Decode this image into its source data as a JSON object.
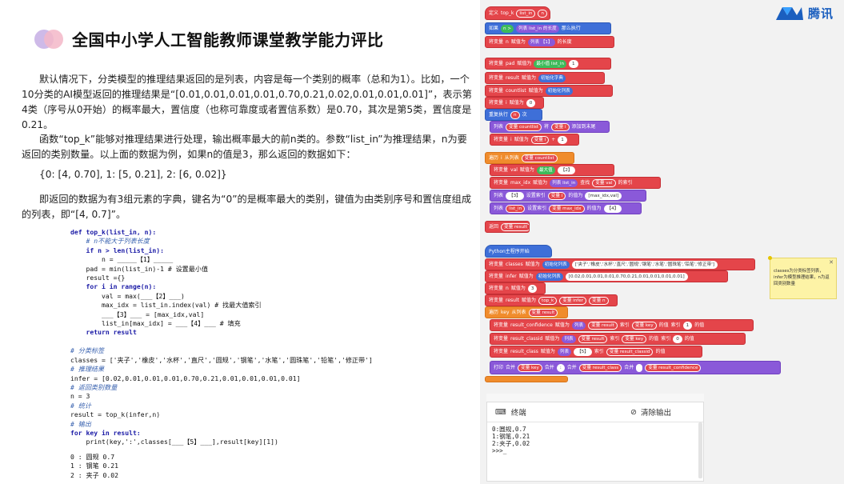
{
  "slide": {
    "title": "全国中小学人工智能教师课堂教学能力评比",
    "p1": "默认情况下，分类模型的推理结果返回的是列表，内容是每一个类别的概率（总和为1）。比如，一个10分类的AI模型返回的推理结果是“[0.01,0.01,0.01,0.01,0.70,0.21,0.02,0.01,0.01,0.01]”，表示第4类（序号从0开始）的概率最大，置信度（也称可靠度或者置信系数）是0.70，其次是第5类，置信度是0.21。",
    "p2": "函数“top_k”能够对推理结果进行处理，输出概率最大的前n类的。参数“list_in”为推理结果，n为要返回的类别数量。以上面的数据为例，如果n的值是3，那么返回的数据如下：",
    "p3": "{0: [4, 0.70], 1: [5, 0.21], 2: [6, 0.02]}",
    "p4": "即返回的数据为有3组元素的字典，键名为“0”的是概率最大的类别，键值为由类别序号和置信度组成的列表，即“[4, 0.7]”。",
    "code": [
      "def top_k(list_in, n):",
      "    # n不能大于列表长度",
      "    if n > len(list_in):",
      "        n = _____【1】_____",
      "    pad = min(list_in)-1 # 设置最小值",
      "    result ={}",
      "    for i in range(n):",
      "        val = max(___【2】___)",
      "        max_idx = list_in.index(val) # 找最大值索引",
      "        ___【3】___ = [max_idx,val]",
      "        list_in[max_idx] = ___【4】___ # 填充",
      "    return result",
      "",
      "# 分类标签",
      "classes = ['夹子','橡皮','水杯','直尺','圆规','钢笔','水笔','圆珠笔','铅笔','修正带']",
      "# 推理结果",
      "infer = [0.02,0.01,0.01,0.01,0.70,0.21,0.01,0.01,0.01,0.01]",
      "# 返回类别数量",
      "n = 3",
      "# 统计",
      "result = top_k(infer,n)",
      "# 输出",
      "for key in result:",
      "    print(key,':',classes[___【5】___],result[key][1])"
    ],
    "output": [
      "0 : 圆规 0.7",
      "1 : 钢笔 0.21",
      "2 : 夹子 0.02"
    ]
  },
  "brand": {
    "name": "腾讯"
  },
  "blocks": {
    "def": "定义",
    "fname": "top_k",
    "arg1": "list_in",
    "arg2": "n",
    "if": "如果",
    "gt": ">",
    "list_len_a": "列表",
    "list_len_b": "的长度",
    "exec": "那么执行",
    "setvar": "将变量",
    "n": "n",
    "assign": "赋值为",
    "list": "列表",
    "blank1": "【1】",
    "len_suffix": "的长度",
    "pad": "pad",
    "min": "最小值",
    "minus_one": "1",
    "result": "result",
    "empty_dict": "初始化字典",
    "countlist": "countlist",
    "empty_list": "初始化列表",
    "i": "i",
    "zero": "0",
    "repeat": "重复执行",
    "repeat_n": "n",
    "times": "次",
    "append_a": "列表",
    "append_var": "变量 countlist",
    "append_b": "将",
    "append_val": "变量 i",
    "append_c": "添加到末尾",
    "i_plus": "+",
    "one": "1",
    "foreach": "遍历",
    "foreach_var": "i",
    "foreach_in": "从列表",
    "foreach_list": "变量 countlist",
    "val": "val",
    "max": "最大值",
    "blank2": "【2】",
    "max_idx": "max_idx",
    "index_of": "查找",
    "index_val": "变量 val",
    "index_pos": "的索引",
    "blank3": "【3】",
    "set_idx": "设置索引",
    "idx_i": "变量 i",
    "set_to": "的值为",
    "pair": "[max_idx,val]",
    "list_in_set": "list_in",
    "set_idx2": "设置索引",
    "idx_var": "变量 max_idx",
    "set_to2": "的值为",
    "blank4": "【4】",
    "return": "返回",
    "return_val": "变量 result",
    "main": "Python主程序开始",
    "classes": "classes",
    "init_list": "初始化列表",
    "classes_val": "['夹子','橡皮','水杯','直尺','圆规','钢笔','水笔','圆珠笔','铅笔','修正带']",
    "infer": "infer",
    "infer_val": "[0.02,0.01,0.01,0.01,0.70,0.21,0.01,0.01,0.01,0.01]",
    "n_val": "3",
    "call": "top_k",
    "call_a": "变量 infer",
    "call_b": "变量 n",
    "key": "key",
    "in_list": "从列表",
    "result_var": "变量 result",
    "rc": "result_confidence",
    "idx": "索引",
    "key_var": "变量 key",
    "idx1": "1",
    "of": "的值",
    "rcl": "result_classid",
    "idx0": "0",
    "rclass": "result_class",
    "cls_list": "列表",
    "blank5": "【5】",
    "cls_idx": "变量 result_classid",
    "print": "打印",
    "merge": "合并",
    "colon": ":",
    "space": " ",
    "rclass_var": "变量 result_class",
    "rc_var": "变量 result_confidence"
  },
  "note": "classes为分类标签列表，infer为模型推理结果，n为返回类别数量",
  "terminal": {
    "title": "终端",
    "clear": "清除输出",
    "lines": [
      "0:圆规,0.7",
      "1:钢笔,0.21",
      "2:夹子,0.02",
      ">>>_"
    ]
  }
}
